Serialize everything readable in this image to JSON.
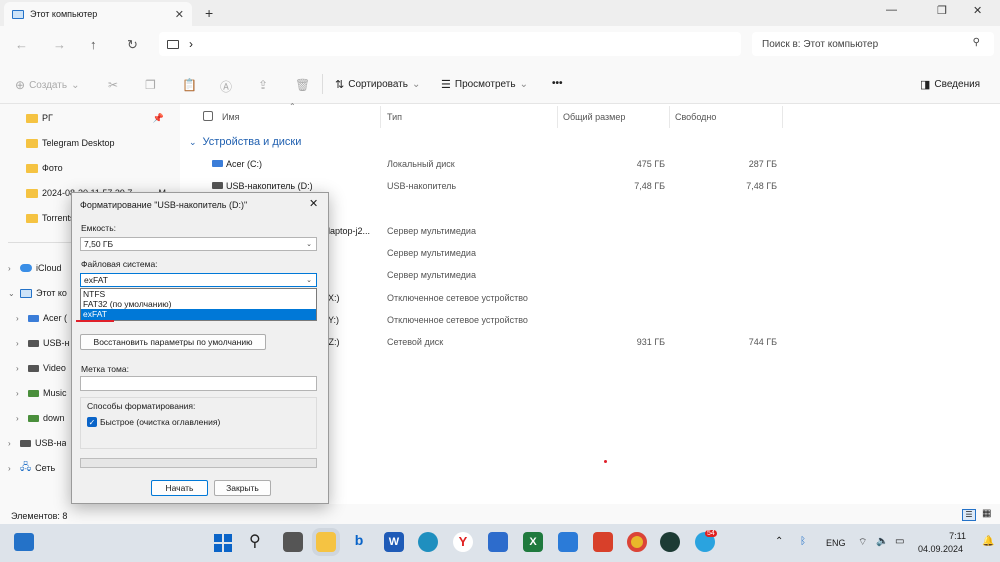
{
  "window": {
    "tab_title": "Этот компьютер",
    "new_tab": "+",
    "minimize": "—",
    "maximize": "❐",
    "close": "✕"
  },
  "nav": {
    "back": "←",
    "forward": "→",
    "up": "↑",
    "refresh": "↻",
    "breadcrumb_sep": "›",
    "search_placeholder": "Поиск в: Этот компьютер"
  },
  "toolbar": {
    "create": "Создать",
    "sort": "Сортировать",
    "view": "Просмотреть",
    "more": "•••",
    "details": "Сведения"
  },
  "sidebar": {
    "pinned": [
      {
        "label": "РГ",
        "pin": true
      },
      {
        "label": "Telegram Desktop"
      },
      {
        "label": "Фото"
      },
      {
        "label": "2024-08-30 11 57 29 7",
        "suffix": "M"
      },
      {
        "label": "Torrents"
      }
    ],
    "tree": [
      {
        "label": "iCloud",
        "icon": "cloud-icon",
        "indent": 0,
        "expanded": false
      },
      {
        "label": "Этот кo",
        "icon": "computer-icon",
        "indent": 0,
        "expanded": true
      },
      {
        "label": "Acer (",
        "icon": "drive-icon",
        "indent": 1
      },
      {
        "label": "USB-н",
        "icon": "usb-drive-icon",
        "indent": 1
      },
      {
        "label": "Video",
        "icon": "media-drive-icon",
        "indent": 1
      },
      {
        "label": "Music",
        "icon": "network-drive-icon",
        "indent": 1
      },
      {
        "label": "down",
        "icon": "network-drive-icon",
        "indent": 1
      },
      {
        "label": "USB-на",
        "icon": "usb-drive-icon",
        "indent": 0
      },
      {
        "label": "Сеть",
        "icon": "network-icon",
        "indent": 0
      }
    ]
  },
  "columns": {
    "name": "Имя",
    "type": "Тип",
    "total": "Общий размер",
    "free": "Свободно"
  },
  "group": "Устройства и диски",
  "rows": [
    {
      "name": "Acer (C:)",
      "type": "Локальный диск",
      "total": "475 ГБ",
      "free": "287 ГБ"
    },
    {
      "name": "USB-накопитель (D:)",
      "type": "USB-накопитель",
      "total": "7,48 ГБ",
      "free": "7,48 ГБ"
    },
    {
      "name": "laptop-j2...",
      "type": "Сервер мультимедиа",
      "total": "",
      "free": ""
    },
    {
      "name": "",
      "type": "Сервер мультимедиа",
      "total": "",
      "free": ""
    },
    {
      "name": "",
      "type": "Сервер мультимедиа",
      "total": "",
      "free": ""
    },
    {
      "name": "X:)",
      "type": "Отключенное сетевое устройство",
      "total": "",
      "free": ""
    },
    {
      "name": "Y:)",
      "type": "Отключенное сетевое устройство",
      "total": "",
      "free": ""
    },
    {
      "name": ") (Z:)",
      "type": "Сетевой диск",
      "total": "931 ГБ",
      "free": "744 ГБ"
    }
  ],
  "status": {
    "items": "Элементов: 8"
  },
  "dialog": {
    "title": "Форматирование \"USB-накопитель (D:)\"",
    "close": "✕",
    "capacity_label": "Емкость:",
    "capacity_value": "7,50 ГБ",
    "fs_label": "Файловая система:",
    "fs_value": "exFAT",
    "fs_options": [
      "NTFS",
      "FAT32 (по умолчанию)",
      "exFAT"
    ],
    "fs_selected_index": 2,
    "restore_button": "Восстановить параметры по умолчанию",
    "volume_label": "Метка тома:",
    "volume_value": "",
    "format_options_label": "Способы форматирования:",
    "quick_format": "Быстрое (очистка оглавления)",
    "quick_format_checked": true,
    "start_button": "Начать",
    "close_button": "Закрыть"
  },
  "taskbar": {
    "lang": "ENG",
    "time": "7:11",
    "date": "04.09.2024",
    "telegram_badge": "54"
  },
  "colors": {
    "accent": "#0a64c8",
    "selection": "#0078d7",
    "annotation": "#e0202a"
  }
}
